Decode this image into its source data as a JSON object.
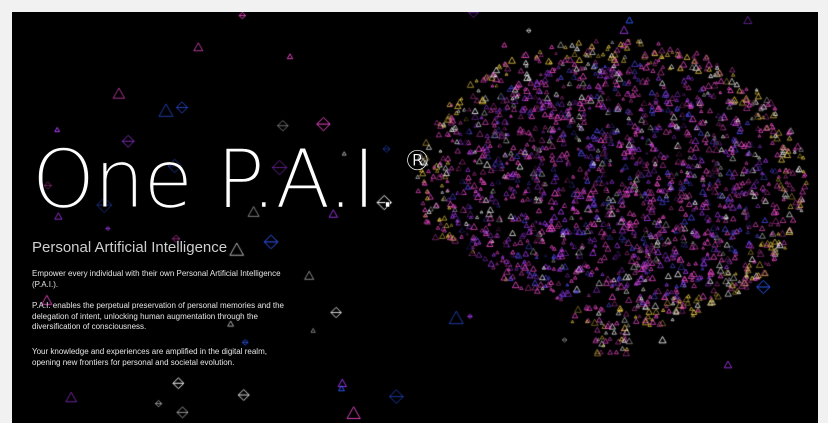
{
  "hero": {
    "title": "One P.A.I.",
    "registered_mark": "®",
    "subtitle": "Personal Artificial Intelligence"
  },
  "paragraphs": [
    "Empower every individual with their own Personal Artificial Intelligence (P.A.I.).",
    "P.A.I. enables the perpetual preservation of personal memories and the delegation of intent, unlocking human augmentation through the diversification of consciousness.",
    "Your knowledge and experiences are amplified in the digital realm, opening new frontiers for personal and societal evolution."
  ],
  "visual": {
    "brain_icon": "neural-brain-particle-visual",
    "palette": [
      "#ff4fd8",
      "#b03cff",
      "#5a4dff",
      "#2f5bff",
      "#ffd84a",
      "#ffffff"
    ]
  }
}
